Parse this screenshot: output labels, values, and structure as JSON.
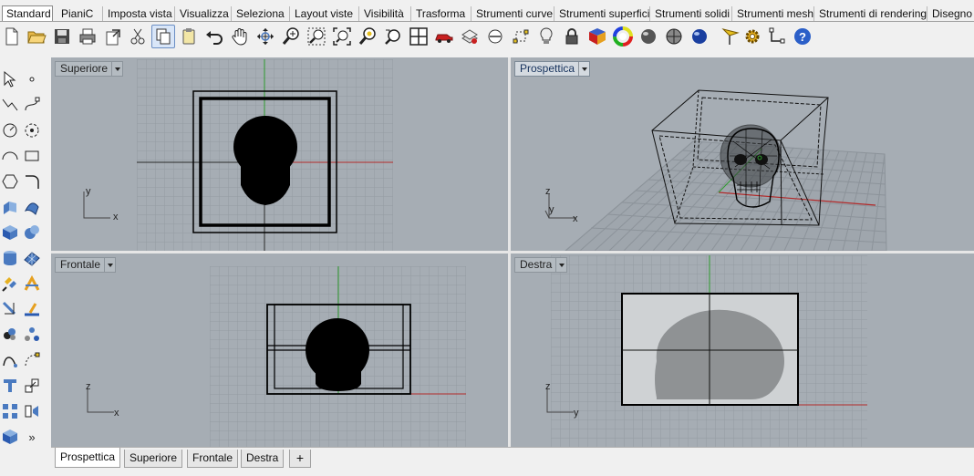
{
  "ribbon": {
    "tabs": [
      "Standard",
      "PianiC",
      "Imposta vista",
      "Visualizza",
      "Seleziona",
      "Layout viste",
      "Visibilità",
      "Trasforma",
      "Strumenti curve",
      "Strumenti superfici",
      "Strumenti solidi",
      "Strumenti mesh",
      "Strumenti di rendering",
      "Disegno"
    ],
    "active_tab": "Standard"
  },
  "toolbar": {
    "icons": [
      "new-file-icon",
      "open-folder-icon",
      "save-icon",
      "print-icon",
      "export-icon",
      "cut-icon",
      "copy-icon",
      "paste-icon",
      "undo-icon",
      "pan-hand-icon",
      "rotate-view-icon",
      "zoom-icon",
      "zoom-window-icon",
      "zoom-extents-icon",
      "zoom-selected-icon",
      "undo-view-icon",
      "four-viewports-icon",
      "car-icon",
      "layer-icon",
      "hide-icon",
      "show-points-icon",
      "light-bulb-icon",
      "lock-icon",
      "material-icon",
      "color-wheel-icon",
      "sphere-icon",
      "render-sphere-icon",
      "chrome-sphere-icon",
      "flag-filter-icon",
      "settings-gear-icon",
      "snap-icon",
      "help-icon"
    ]
  },
  "left_toolbar": {
    "more_label": "»"
  },
  "viewports": {
    "top_left": {
      "label": "Superiore",
      "axis_x": "x",
      "axis_y": "y"
    },
    "top_right": {
      "label": "Prospettica",
      "axis_x": "x",
      "axis_y": "y",
      "axis_z": "z"
    },
    "bottom_left": {
      "label": "Frontale",
      "axis_x": "x",
      "axis_y": "z"
    },
    "bottom_right": {
      "label": "Destra",
      "axis_x": "y",
      "axis_y": "z"
    }
  },
  "bottom_tabs": [
    "Prospettica",
    "Superiore",
    "Frontale",
    "Destra"
  ],
  "bottom_tabs_active": "Prospettica",
  "colors": {
    "viewport_bg": "#a6adb4",
    "grid_line": "#949ba2",
    "x_axis": "#b22a2a",
    "y_axis": "#2e9a2e",
    "selection_blue": "#6a8ec4"
  }
}
